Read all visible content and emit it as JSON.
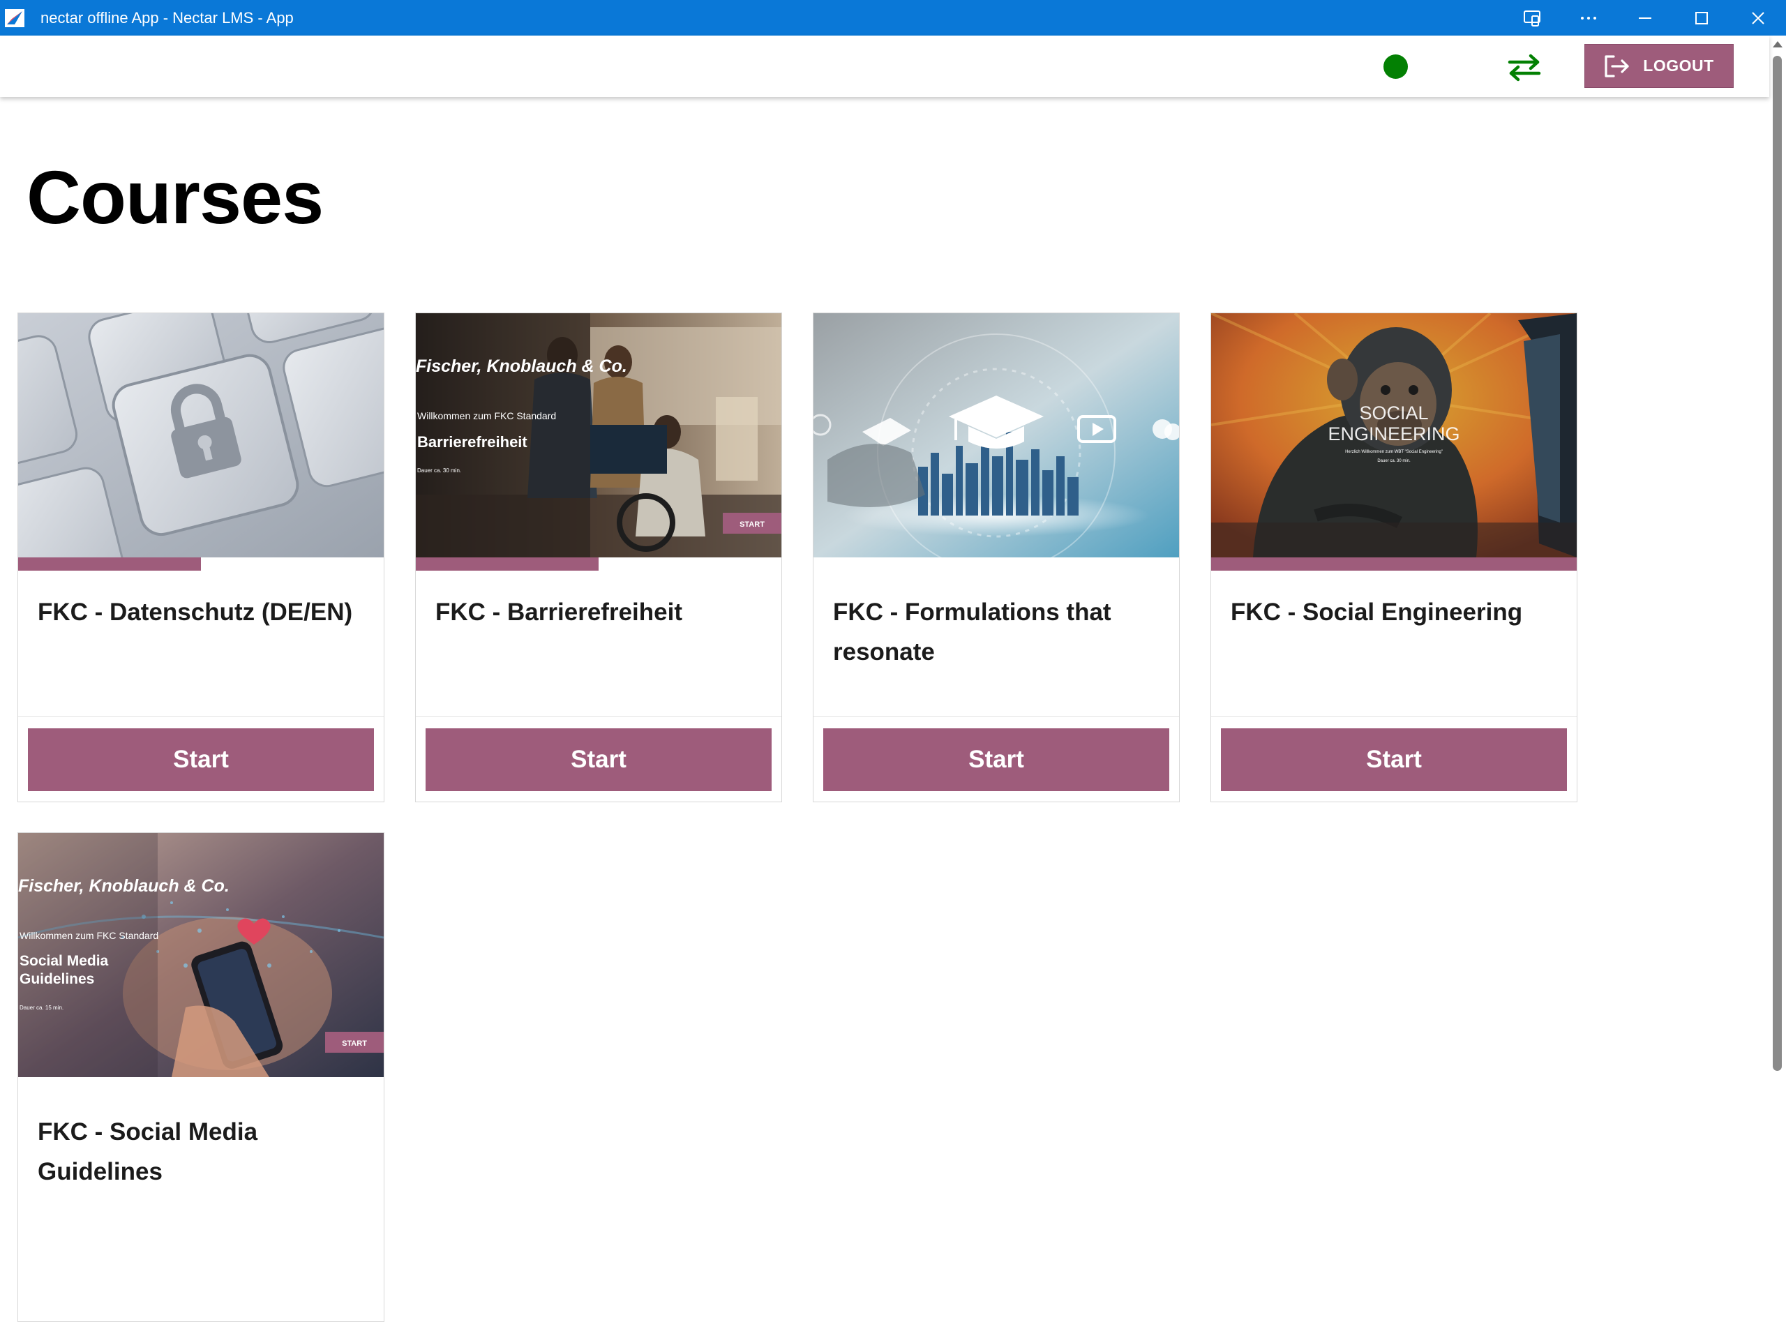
{
  "window": {
    "title": "nectar offline App - Nectar LMS - App"
  },
  "header": {
    "status": "online",
    "status_color": "#038003",
    "logout_label": "LOGOUT"
  },
  "page": {
    "title": "Courses"
  },
  "colors": {
    "accent": "#9e5c7b",
    "titlebar": "#0a78d7"
  },
  "courses": [
    {
      "title": "FKC - Datenschutz (DE/EN)",
      "start_label": "Start",
      "progress_fraction": 0.5,
      "image": "keyboard-lock"
    },
    {
      "title": "FKC - Barrierefreiheit",
      "start_label": "Start",
      "progress_fraction": 0.5,
      "image": "office-people",
      "image_text": {
        "brand": "Fischer, Knoblauch & Co.",
        "welcome": "Willkommen zum FKC Standard",
        "topic": "Barrierefreiheit",
        "duration": "Dauer ca. 30 min.",
        "start": "START"
      }
    },
    {
      "title": "FKC - Formulations that resonate",
      "start_label": "Start",
      "progress_fraction": 0,
      "image": "elearning-city"
    },
    {
      "title": "FKC - Social Engineering",
      "start_label": "Start",
      "progress_fraction": 1.0,
      "image": "chimp-computer",
      "image_text": {
        "line1": "SOCIAL",
        "line2": "ENGINEERING",
        "welcome": "Herzlich Willkommen zum WBT \"Social Engineering\"",
        "duration": "Dauer ca. 30 min."
      }
    },
    {
      "title": "FKC - Social Media Guidelines",
      "start_label": "Start",
      "progress_fraction": 0,
      "image": "phone-hand",
      "image_text": {
        "brand": "Fischer, Knoblauch & Co.",
        "welcome": "Willkommen zum FKC Standard",
        "topic1": "Social Media",
        "topic2": "Guidelines",
        "duration": "Dauer ca. 15 min.",
        "start": "START"
      }
    }
  ]
}
